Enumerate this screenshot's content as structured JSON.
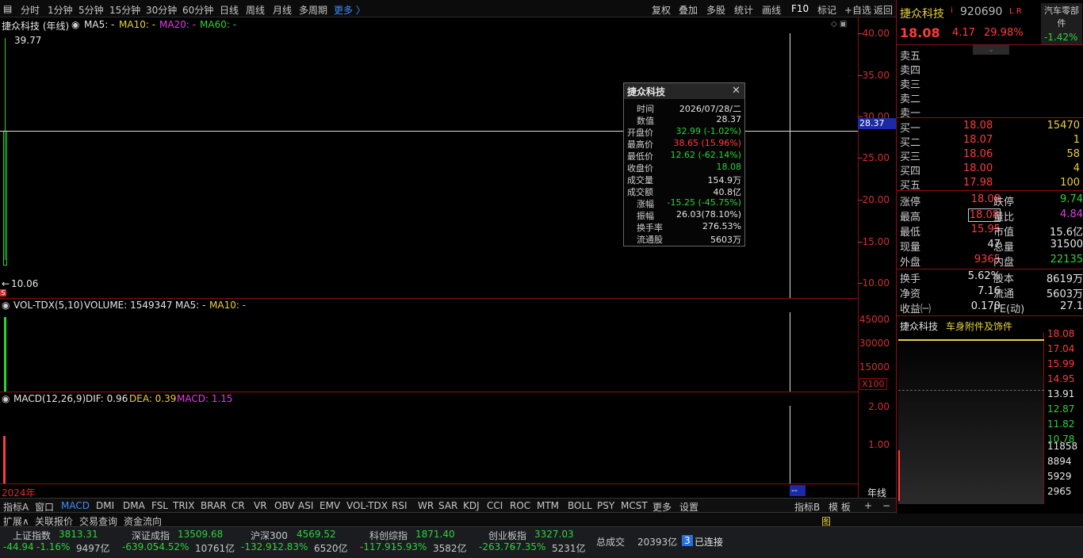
{
  "toolbar": {
    "periods": [
      "分时",
      "1分钟",
      "5分钟",
      "15分钟",
      "30分钟",
      "60分钟",
      "日线",
      "周线",
      "月线",
      "多周期",
      "更多 〉"
    ],
    "right": [
      "复权",
      "叠加",
      "多股",
      "统计",
      "画线",
      "F10",
      "标记",
      "+自选",
      "返回"
    ]
  },
  "main_chart": {
    "title": "捷众科技 (年线)",
    "ma5": "MA5: -",
    "ma10": "MA10: -",
    "ma20": "MA20: -",
    "ma60": "MA60: -",
    "high_label": "39.77",
    "low_label": "10.06",
    "scale": [
      "40.00",
      "35.00",
      "30.00",
      "25.00",
      "20.00",
      "15.00",
      "10.00"
    ],
    "cursor_price": "28.37"
  },
  "volume_pane": {
    "title": "VOL-TDX(5,10)",
    "volume": "VOLUME: 1549347",
    "ma5": "MA5: -",
    "ma10": "MA10: -",
    "scale": [
      "45000",
      "30000",
      "15000"
    ],
    "unit": "X100"
  },
  "macd_pane": {
    "title": "MACD(12,26,9)",
    "dif": "DIF: 0.96",
    "dea": "DEA: 0.39",
    "macd": "MACD: 1.15",
    "scale": [
      "2.00",
      "1.00"
    ]
  },
  "axis": {
    "year_label": "2024年",
    "cursor_label": "--",
    "period_label": "年线"
  },
  "tooltip": {
    "title": "捷众科技",
    "rows": [
      {
        "k": "时间",
        "v": "2026/07/28/二"
      },
      {
        "k": "数值",
        "v": "28.37"
      },
      {
        "k": "开盘价",
        "v": "32.99 (-1.02%)"
      },
      {
        "k": "最高价",
        "v": "38.65 (15.96%)"
      },
      {
        "k": "最低价",
        "v": "12.62 (-62.14%)"
      },
      {
        "k": "收盘价",
        "v": "18.08"
      },
      {
        "k": "成交量",
        "v": "154.9万"
      },
      {
        "k": "成交额",
        "v": "40.8亿"
      },
      {
        "k": "涨幅",
        "v": "-15.25 (-45.75%)"
      },
      {
        "k": "振幅",
        "v": "26.03(78.10%)"
      },
      {
        "k": "换手率",
        "v": "276.53%"
      },
      {
        "k": "流通股",
        "v": "5603万"
      }
    ]
  },
  "tabs": [
    "指标A",
    "窗口",
    "MACD",
    "DMI",
    "DMA",
    "FSL",
    "TRIX",
    "BRAR",
    "CR",
    "VR",
    "OBV",
    "ASI",
    "EMV",
    "VOL-TDX",
    "RSI",
    "WR",
    "SAR",
    "KDJ",
    "CCI",
    "ROC",
    "MTM",
    "BOLL",
    "PSY",
    "MCST",
    "更多",
    "设置"
  ],
  "tabs_right": [
    "指标B",
    "模 板",
    "+",
    "−"
  ],
  "bottom_tabs": [
    "扩展∧",
    "关联报价",
    "交易查询",
    "资金流向"
  ],
  "bottom_icon": "图",
  "stock": {
    "name": "捷众科技",
    "code": "920690",
    "flags": "L R",
    "info_mark": "i",
    "price": "18.08",
    "change": "4.17",
    "pct": "29.98%",
    "sector": "汽车零部件",
    "sector_pct": "-1.42%",
    "sell_labels": [
      "卖五",
      "卖四",
      "卖三",
      "卖二",
      "卖一"
    ],
    "buys": [
      {
        "label": "买一",
        "price": "18.08",
        "vol": "15470"
      },
      {
        "label": "买二",
        "price": "18.07",
        "vol": "1"
      },
      {
        "label": "买三",
        "price": "18.06",
        "vol": "58"
      },
      {
        "label": "买四",
        "price": "18.00",
        "vol": "4"
      },
      {
        "label": "买五",
        "price": "17.98",
        "vol": "100"
      }
    ],
    "stats": [
      {
        "k1": "涨停",
        "v1": "18.08",
        "k2": "跌停",
        "v2": "9.74"
      },
      {
        "k1": "最高",
        "v1": "18.08",
        "k2": "量比",
        "v2": "4.84"
      },
      {
        "k1": "最低",
        "v1": "15.95",
        "k2": "市值",
        "v2": "15.6亿"
      },
      {
        "k1": "现量",
        "v1": "47",
        "k2": "总量",
        "v2": "31500"
      },
      {
        "k1": "外盘",
        "v1": "9365",
        "k2": "内盘",
        "v2": "22135"
      }
    ],
    "stats2": [
      {
        "k1": "换手",
        "v1": "5.62%",
        "k2": "股本",
        "v2": "8619万"
      },
      {
        "k1": "净资",
        "v1": "7.16",
        "k2": "流通",
        "v2": "5603万"
      },
      {
        "k1": "收益㈠",
        "v1": "0.170",
        "k2": "PE(动)",
        "v2": "27.1"
      }
    ],
    "mini_title": "捷众科技",
    "mini_sector": "车身附件及饰件",
    "mini_scale": [
      "18.08",
      "17.04",
      "15.99",
      "14.95",
      "13.91",
      "12.87",
      "11.82",
      "10.78"
    ],
    "mini_vol_scale": [
      "11858",
      "8894",
      "5929",
      "2965"
    ]
  },
  "indices": [
    {
      "name": "上证指数",
      "value": "3813.31",
      "chg": "-44.94",
      "pct": "-1.16%",
      "amt": "9497亿"
    },
    {
      "name": "深证成指",
      "value": "13509.68",
      "chg": "-639.05",
      "pct": "-4.52%",
      "amt": "10761亿"
    },
    {
      "name": "沪深300",
      "value": "4569.52",
      "chg": "-132.91",
      "pct": "-2.83%",
      "amt": "6520亿"
    },
    {
      "name": "科创综指",
      "value": "1871.40",
      "chg": "-117.91",
      "pct": "-5.93%",
      "amt": "3582亿"
    },
    {
      "name": "创业板指",
      "value": "3327.03",
      "chg": "-263.76",
      "pct": "-7.35%",
      "amt": "5231亿"
    }
  ],
  "total": {
    "label": "总成交",
    "value": "20393亿",
    "conn_count": "3",
    "conn_label": "已连接"
  },
  "colors": {
    "up": "#ff3c3c",
    "down": "#2ed23a",
    "border": "#8c1010"
  }
}
